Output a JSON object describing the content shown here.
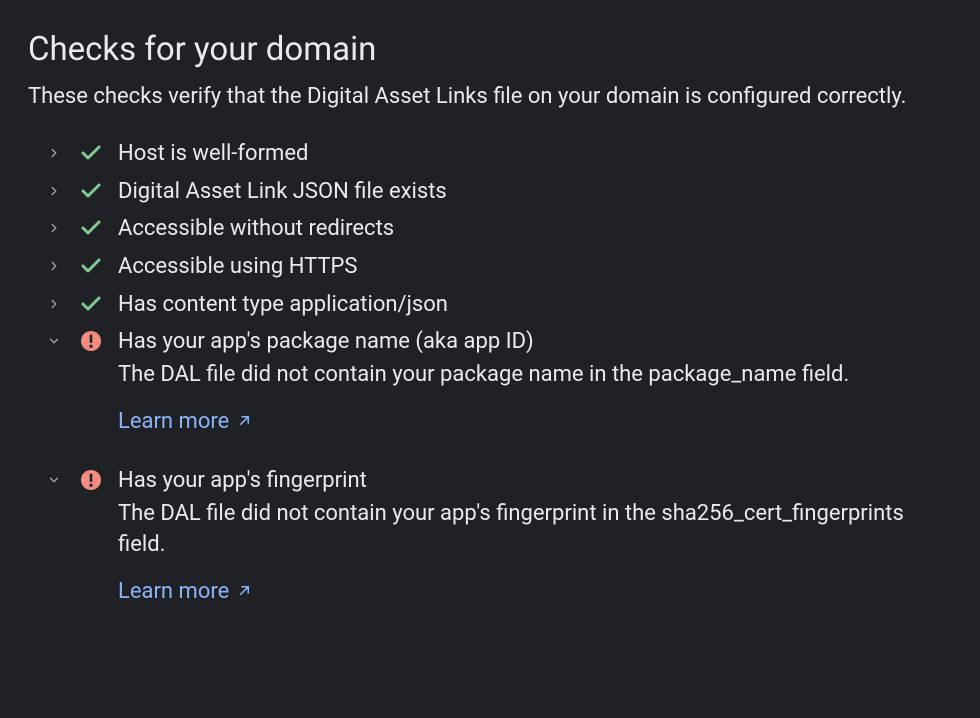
{
  "header": {
    "title": "Checks for your domain",
    "subtitle": "These checks verify that the Digital Asset Links file on your domain is configured correctly."
  },
  "checks": [
    {
      "status": "pass",
      "expanded": false,
      "title": "Host is well-formed"
    },
    {
      "status": "pass",
      "expanded": false,
      "title": "Digital Asset Link JSON file exists"
    },
    {
      "status": "pass",
      "expanded": false,
      "title": "Accessible without redirects"
    },
    {
      "status": "pass",
      "expanded": false,
      "title": "Accessible using HTTPS"
    },
    {
      "status": "pass",
      "expanded": false,
      "title": "Has content type application/json"
    },
    {
      "status": "fail",
      "expanded": true,
      "title": "Has your app's package name (aka app ID)",
      "description": "The DAL file did not contain your package name in the package_name field.",
      "learn_more_label": "Learn more"
    },
    {
      "status": "fail",
      "expanded": true,
      "title": "Has your app's fingerprint",
      "description": "The DAL file did not contain your app's fingerprint in the sha256_cert_fingerprints field.",
      "learn_more_label": "Learn more"
    }
  ],
  "colors": {
    "background": "#202124",
    "text": "#e8eaed",
    "muted": "#9aa0a6",
    "success": "#81c995",
    "error": "#f28b82",
    "link": "#8ab4f8"
  }
}
